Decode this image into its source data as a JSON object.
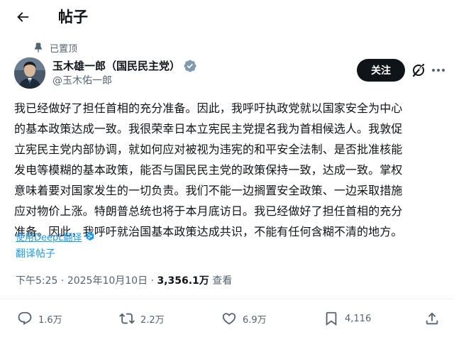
{
  "header": {
    "title": "帖子",
    "back_icon": "arrow-left-icon"
  },
  "post": {
    "pinned_label": "已置顶",
    "author": {
      "name": "玉木雄一郎（国民民主党）",
      "handle": "@玉木佑一郎",
      "verified_icon": "verified-badge-icon",
      "verified_color": "#829aab"
    },
    "follow_label": "关注",
    "body_lines": [
      "我已经做好了担任首相的充分准备。因此，我呼吁执政党就以国家安全为中心",
      "的基本政策达成一致。我很荣幸日本立宪民主党提名我为首相候选人。我敦促",
      "立宪民主党内部协调，就如何应对被视为违宪的和平安全法制、是否批准核能",
      "发电等模糊的基本政策，能否与国民民主党的政策保持一致，达成一致。掌权",
      "意味着要对国家发生的一切负责。我们不能一边搁置安全政策、一边采取措施",
      "应对物价上涨。特朗普总统也将于本月底访日。我已经做好了担任首相的充分",
      "准备。因此，我呼吁就治国基本政策达成共识，不能有任何含糊不清的地方。"
    ],
    "translated_with": "使用DeepL翻译",
    "translate_post": "翻译帖子",
    "time": "下午5:25",
    "date": "2025年10月10日",
    "views_count": "3,356.1万",
    "views_label": "查看"
  },
  "actions": {
    "replies": "1.6万",
    "reposts": "2.2万",
    "likes": "6.9万",
    "bookmarks": "4,116"
  },
  "colors": {
    "accent": "#1d9bf0",
    "text": "#0f1419",
    "secondary": "#536471",
    "follow_bg": "#0f1419"
  }
}
